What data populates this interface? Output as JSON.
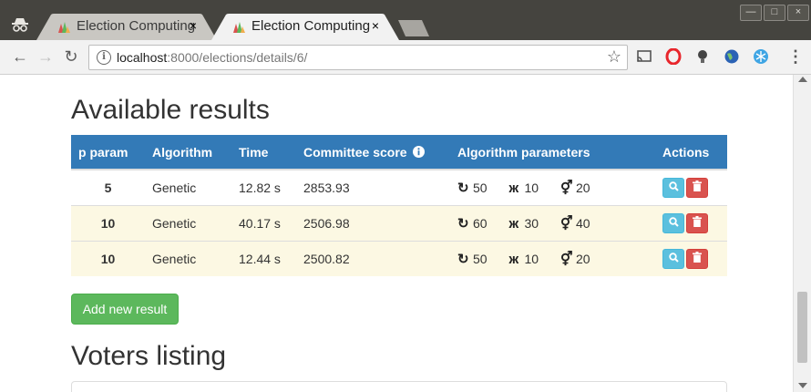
{
  "browser": {
    "tabs": [
      {
        "title": "Election Computing",
        "close": "×",
        "state": "inactive"
      },
      {
        "title": "Election Computing",
        "close": "×",
        "state": "active"
      }
    ],
    "window_controls": {
      "minimize": "—",
      "maximize": "□",
      "close": "×"
    },
    "url_host": "localhost",
    "url_rest": ":8000/elections/details/6/"
  },
  "page": {
    "results_heading": "Available results",
    "table": {
      "headers": [
        "p param",
        "Algorithm",
        "Time",
        "Committee score",
        "Algorithm parameters",
        "Actions"
      ],
      "rows": [
        {
          "p": "5",
          "algorithm": "Genetic",
          "time": "12.82 s",
          "score": "2853.93",
          "params": [
            "50",
            "10",
            "20"
          ],
          "style": "default"
        },
        {
          "p": "10",
          "algorithm": "Genetic",
          "time": "40.17 s",
          "score": "2506.98",
          "params": [
            "60",
            "30",
            "40"
          ],
          "style": "warning"
        },
        {
          "p": "10",
          "algorithm": "Genetic",
          "time": "12.44 s",
          "score": "2500.82",
          "params": [
            "50",
            "10",
            "20"
          ],
          "style": "warning"
        }
      ]
    },
    "add_button": "Add new result",
    "voters_heading": "Voters listing"
  },
  "colors": {
    "table_header": "#337ab7",
    "row_warning": "#fcf8e3",
    "success": "#5cb85c",
    "info": "#5bc0de",
    "danger": "#d9534f"
  }
}
